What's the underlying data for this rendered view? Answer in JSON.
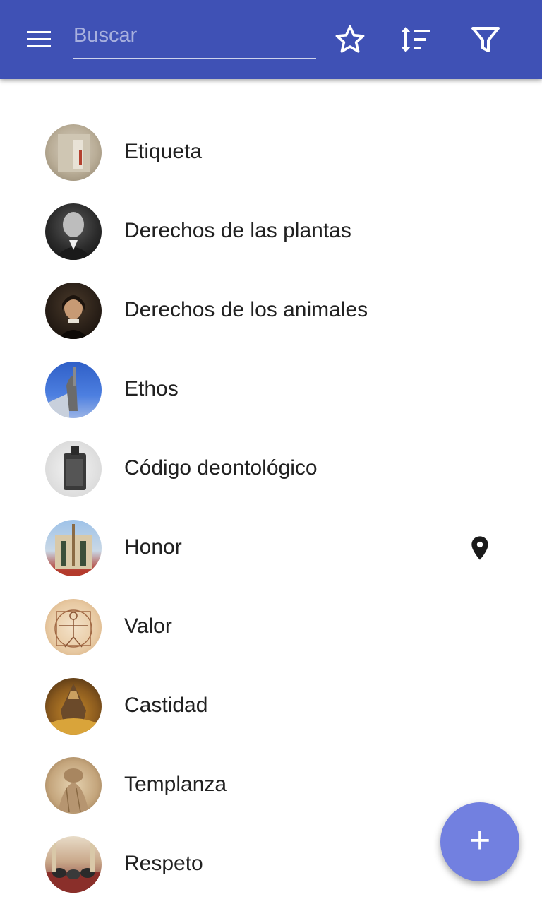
{
  "appbar": {
    "search_placeholder": "Buscar",
    "search_value": "",
    "icons": [
      "menu-icon",
      "star-icon",
      "sort-icon",
      "filter-icon"
    ]
  },
  "list": {
    "items": [
      {
        "label": "Etiqueta",
        "avatar": "photo",
        "has_location": false
      },
      {
        "label": "Derechos de las plantas",
        "avatar": "photo",
        "has_location": false
      },
      {
        "label": "Derechos de los animales",
        "avatar": "photo",
        "has_location": false
      },
      {
        "label": "Ethos",
        "avatar": "photo",
        "has_location": false
      },
      {
        "label": "Código deontológico",
        "avatar": "photo",
        "has_location": false
      },
      {
        "label": "Honor",
        "avatar": "photo",
        "has_location": true
      },
      {
        "label": "Valor",
        "avatar": "photo",
        "has_location": false
      },
      {
        "label": "Castidad",
        "avatar": "photo",
        "has_location": false
      },
      {
        "label": "Templanza",
        "avatar": "photo",
        "has_location": false
      },
      {
        "label": "Respeto",
        "avatar": "photo",
        "has_location": false
      }
    ]
  },
  "fab": {
    "icon": "plus-icon",
    "label": "+"
  },
  "colors": {
    "primary": "#3f51b5",
    "accent": "#7280e0",
    "text": "#212121"
  }
}
